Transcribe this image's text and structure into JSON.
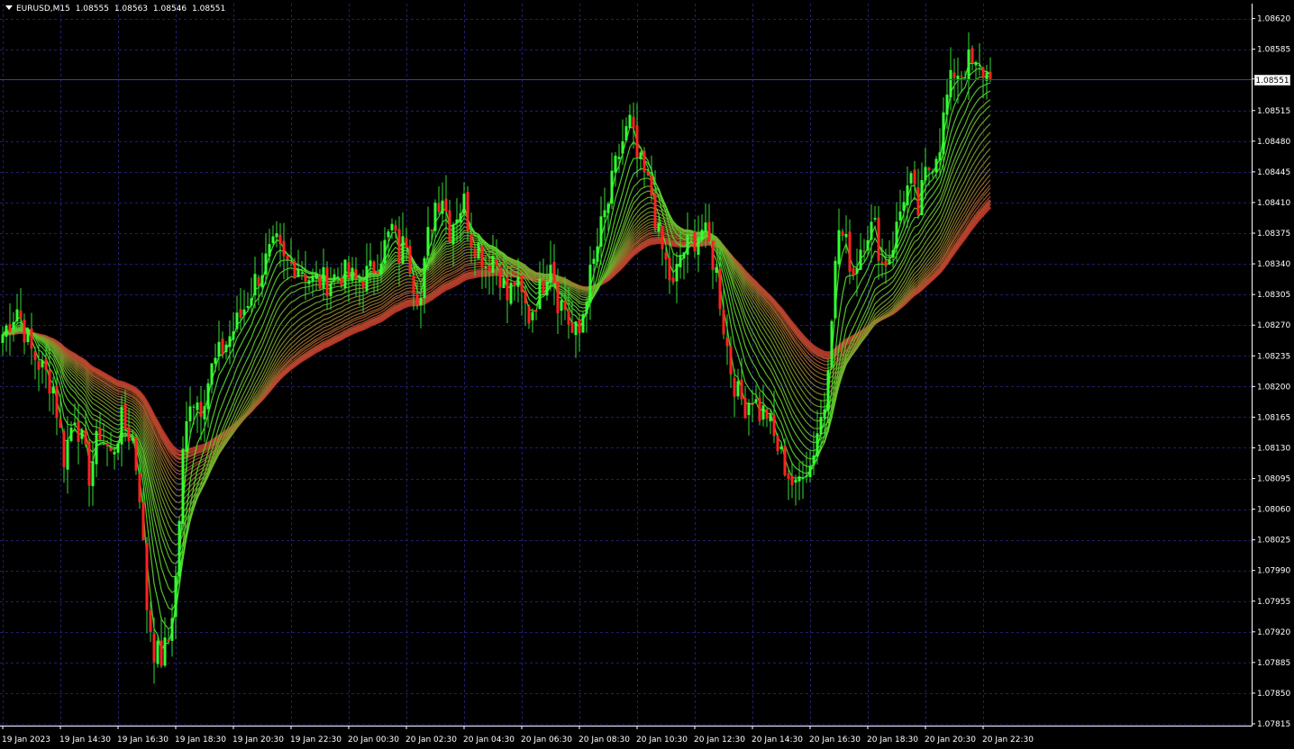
{
  "header": {
    "symbol": "EURUSD,M15",
    "open": "1.08555",
    "high": "1.08563",
    "low": "1.08546",
    "close": "1.08551"
  },
  "current_price": "1.08551",
  "colors": {
    "background": "#000000",
    "grid": "#1e1e6e",
    "axis": "#ffffff",
    "bull_candle": "#33ff33",
    "bear_candle": "#ff2222",
    "wick": "#33dd33",
    "ribbon_fast": "#4ee62e",
    "ribbon_slow": "#c23a2e",
    "price_line": "#3a3aa8"
  },
  "chart_data": {
    "type": "candlestick",
    "symbol": "EURUSD",
    "timeframe": "M15",
    "ylim": [
      1.07815,
      1.08635
    ],
    "y_ticks": [
      "1.08620",
      "1.08585",
      "1.08551",
      "1.08515",
      "1.08480",
      "1.08445",
      "1.08410",
      "1.08375",
      "1.08340",
      "1.08305",
      "1.08270",
      "1.08235",
      "1.08200",
      "1.08165",
      "1.08130",
      "1.08095",
      "1.08060",
      "1.08025",
      "1.07990",
      "1.07955",
      "1.07920",
      "1.07885",
      "1.07850",
      "1.07815"
    ],
    "x_ticks": [
      "19 Jan 2023",
      "19 Jan 14:30",
      "19 Jan 16:30",
      "19 Jan 18:30",
      "19 Jan 20:30",
      "19 Jan 22:30",
      "20 Jan 00:30",
      "20 Jan 02:30",
      "20 Jan 04:30",
      "20 Jan 06:30",
      "20 Jan 08:30",
      "20 Jan 10:30",
      "20 Jan 12:30",
      "20 Jan 14:30",
      "20 Jan 16:30",
      "20 Jan 18:30",
      "20 Jan 20:30",
      "20 Jan 22:30"
    ],
    "x_tick_positions_bars": [
      0,
      16,
      32,
      48,
      64,
      80,
      96,
      112,
      128,
      144,
      160,
      176,
      192,
      208,
      224,
      240,
      256,
      272
    ],
    "bar_count": 275,
    "price_anchors": [
      [
        0,
        1.0826
      ],
      [
        4,
        1.0829
      ],
      [
        8,
        1.0824
      ],
      [
        14,
        1.082
      ],
      [
        17,
        1.0812
      ],
      [
        20,
        1.0817
      ],
      [
        24,
        1.081
      ],
      [
        27,
        1.0815
      ],
      [
        30,
        1.0812
      ],
      [
        33,
        1.0816
      ],
      [
        36,
        1.0814
      ],
      [
        38,
        1.0808
      ],
      [
        40,
        1.0795
      ],
      [
        42,
        1.079
      ],
      [
        44,
        1.0789
      ],
      [
        46,
        1.0791
      ],
      [
        48,
        1.0798
      ],
      [
        50,
        1.0812
      ],
      [
        52,
        1.0819
      ],
      [
        55,
        1.0818
      ],
      [
        58,
        1.0822
      ],
      [
        62,
        1.0825
      ],
      [
        66,
        1.0828
      ],
      [
        70,
        1.0832
      ],
      [
        74,
        1.0835
      ],
      [
        76,
        1.0836
      ],
      [
        78,
        1.0834
      ],
      [
        82,
        1.0834
      ],
      [
        86,
        1.0832
      ],
      [
        90,
        1.0832
      ],
      [
        94,
        1.0833
      ],
      [
        98,
        1.0832
      ],
      [
        102,
        1.0833
      ],
      [
        106,
        1.0836
      ],
      [
        108,
        1.0838
      ],
      [
        110,
        1.0835
      ],
      [
        112,
        1.0837
      ],
      [
        114,
        1.0832
      ],
      [
        116,
        1.083
      ],
      [
        118,
        1.0837
      ],
      [
        120,
        1.0841
      ],
      [
        122,
        1.0842
      ],
      [
        124,
        1.0838
      ],
      [
        126,
        1.084
      ],
      [
        128,
        1.0841
      ],
      [
        130,
        1.0837
      ],
      [
        132,
        1.0836
      ],
      [
        134,
        1.0834
      ],
      [
        136,
        1.0835
      ],
      [
        138,
        1.0833
      ],
      [
        140,
        1.083
      ],
      [
        142,
        1.0832
      ],
      [
        144,
        1.083
      ],
      [
        146,
        1.0828
      ],
      [
        148,
        1.083
      ],
      [
        150,
        1.0832
      ],
      [
        152,
        1.0835
      ],
      [
        154,
        1.083
      ],
      [
        156,
        1.0829
      ],
      [
        158,
        1.0826
      ],
      [
        160,
        1.0826
      ],
      [
        162,
        1.0831
      ],
      [
        164,
        1.0834
      ],
      [
        166,
        1.0838
      ],
      [
        168,
        1.0841
      ],
      [
        170,
        1.0845
      ],
      [
        172,
        1.0848
      ],
      [
        174,
        1.085
      ],
      [
        176,
        1.0846
      ],
      [
        178,
        1.0844
      ],
      [
        180,
        1.0842
      ],
      [
        182,
        1.0837
      ],
      [
        184,
        1.0834
      ],
      [
        186,
        1.0831
      ],
      [
        188,
        1.0835
      ],
      [
        190,
        1.0836
      ],
      [
        192,
        1.0837
      ],
      [
        194,
        1.0838
      ],
      [
        196,
        1.0836
      ],
      [
        198,
        1.0833
      ],
      [
        200,
        1.0827
      ],
      [
        202,
        1.0822
      ],
      [
        204,
        1.0819
      ],
      [
        206,
        1.0818
      ],
      [
        208,
        1.0819
      ],
      [
        210,
        1.0817
      ],
      [
        212,
        1.0817
      ],
      [
        214,
        1.0814
      ],
      [
        216,
        1.0812
      ],
      [
        218,
        1.081
      ],
      [
        220,
        1.0808
      ],
      [
        222,
        1.0811
      ],
      [
        224,
        1.0811
      ],
      [
        226,
        1.0815
      ],
      [
        228,
        1.0818
      ],
      [
        230,
        1.0829
      ],
      [
        232,
        1.0838
      ],
      [
        234,
        1.0836
      ],
      [
        236,
        1.0833
      ],
      [
        238,
        1.0836
      ],
      [
        240,
        1.0838
      ],
      [
        242,
        1.0838
      ],
      [
        244,
        1.0834
      ],
      [
        246,
        1.0835
      ],
      [
        248,
        1.0838
      ],
      [
        250,
        1.0842
      ],
      [
        252,
        1.0843
      ],
      [
        254,
        1.084
      ],
      [
        256,
        1.0844
      ],
      [
        258,
        1.0846
      ],
      [
        260,
        1.0848
      ],
      [
        262,
        1.0853
      ],
      [
        264,
        1.0856
      ],
      [
        266,
        1.0856
      ],
      [
        268,
        1.0857
      ],
      [
        270,
        1.0856
      ],
      [
        272,
        1.0856
      ],
      [
        274,
        1.08551
      ]
    ],
    "last_price": 1.08551,
    "indicators": [
      {
        "type": "ma_ribbon",
        "lines": 24,
        "min_period": 3,
        "max_period": 70,
        "fast_color": "#4ee62e",
        "slow_color": "#c23a2e"
      }
    ],
    "grid": true
  }
}
